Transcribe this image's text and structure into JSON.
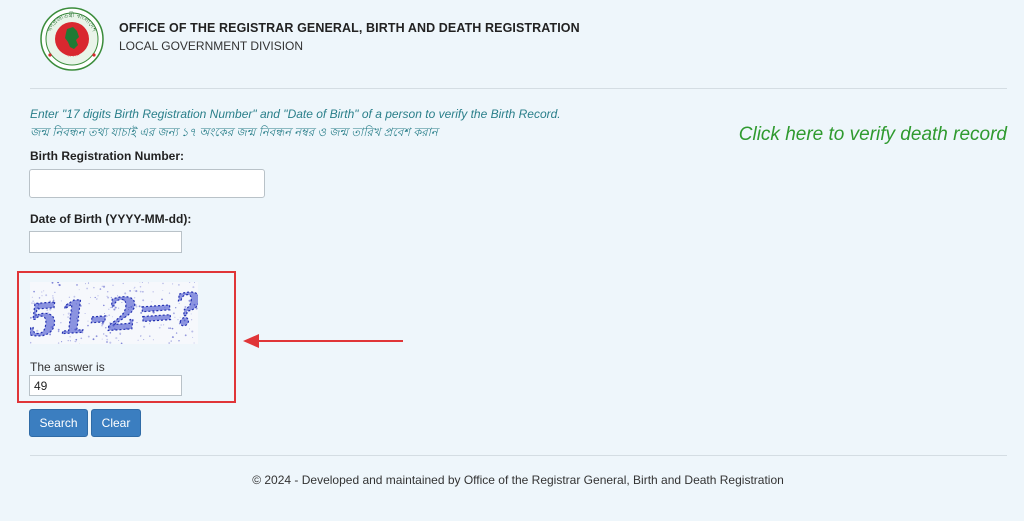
{
  "header": {
    "title": "OFFICE OF THE REGISTRAR GENERAL, BIRTH AND DEATH REGISTRATION",
    "subtitle": "LOCAL GOVERNMENT DIVISION",
    "logo_icon": "government-seal-icon",
    "logo_text_top": "গণপ্রজাতন্ত্রী বাংলাদেশ",
    "logo_text_bottom": "সরকার"
  },
  "instructions": {
    "english": "Enter \"17 digits Birth Registration Number\" and \"Date of Birth\" of a person to verify the Birth Record.",
    "bangla": "জন্ম নিবন্ধন তথ্য যাচাই এর জন্য ১৭ অংকের জন্ম নিবন্ধন নম্বর ও জন্ম তারিখ প্রবেশ করান"
  },
  "death_link": "Click here to verify death record",
  "form": {
    "brn_label": "Birth Registration Number:",
    "brn_value": "",
    "dob_label": "Date of Birth (YYYY-MM-dd):",
    "dob_value": "",
    "captcha_text": "51-2=?",
    "answer_label": "The answer is",
    "answer_value": "49"
  },
  "buttons": {
    "search": "Search",
    "clear": "Clear"
  },
  "footer": "© 2024 - Developed and maintained by Office of the Registrar General, Birth and Death Registration",
  "colors": {
    "background": "#eef6fb",
    "accent_button": "#3b7ec0",
    "link_green": "#2f9a2f",
    "highlight_red": "#e03538",
    "instruction_teal": "#2a7f8a"
  }
}
